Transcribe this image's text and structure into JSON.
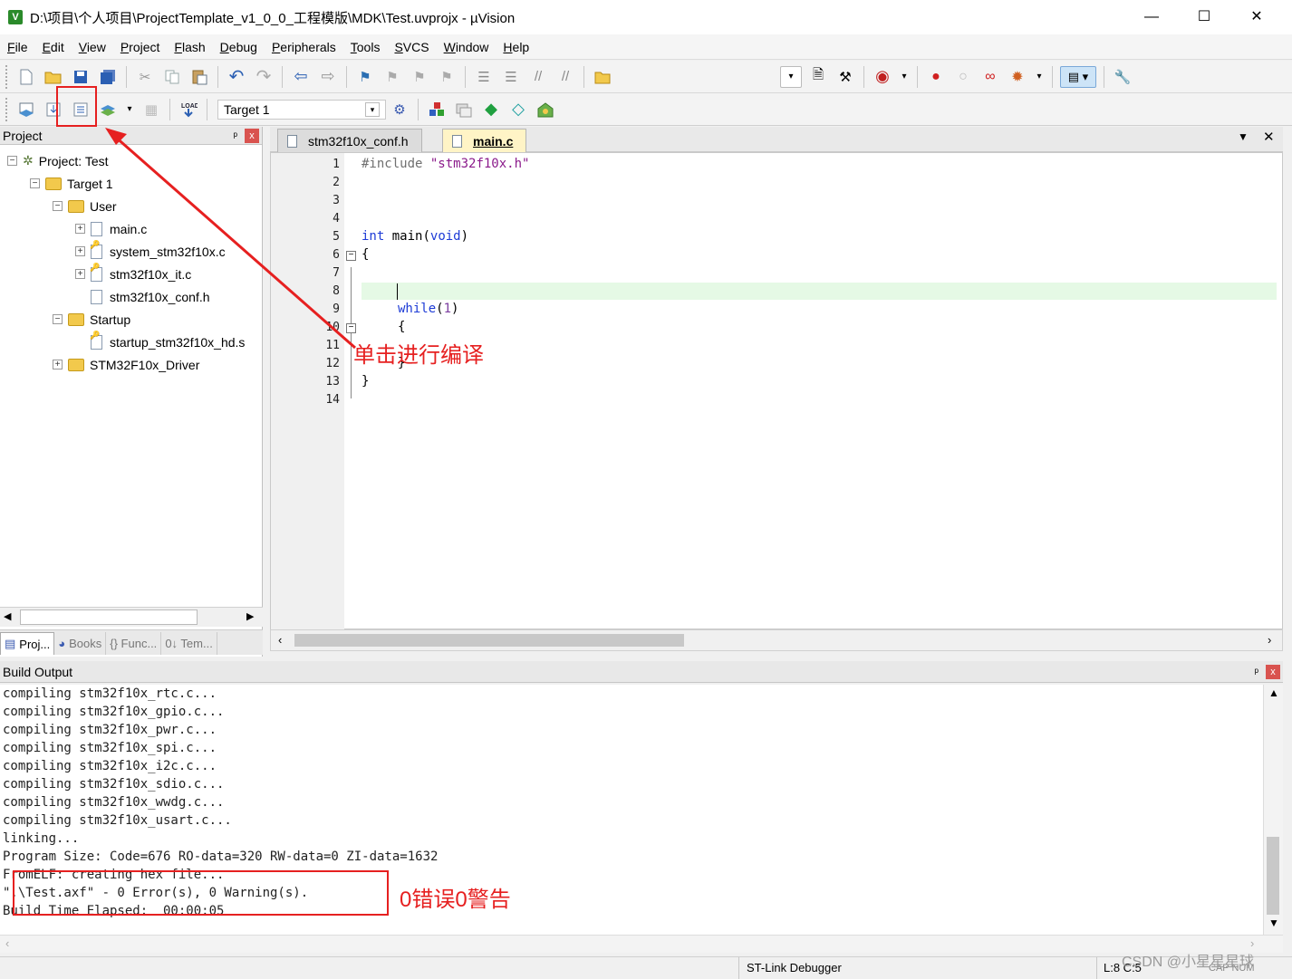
{
  "window": {
    "title": "D:\\项目\\个人项目\\ProjectTemplate_v1_0_0_工程模版\\MDK\\Test.uvprojx - µVision",
    "app_icon": "V",
    "minimize": "—",
    "maximize": "☐",
    "close": "✕"
  },
  "menu": {
    "items": [
      {
        "label": "File",
        "accel": "F",
        "rest": "ile"
      },
      {
        "label": "Edit",
        "accel": "E",
        "rest": "dit"
      },
      {
        "label": "View",
        "accel": "V",
        "rest": "iew"
      },
      {
        "label": "Project",
        "accel": "P",
        "rest": "roject"
      },
      {
        "label": "Flash",
        "accel": "F",
        "rest": "lash"
      },
      {
        "label": "Debug",
        "accel": "D",
        "rest": "ebug"
      },
      {
        "label": "Peripherals",
        "accel": "P",
        "rest": "eripherals"
      },
      {
        "label": "Tools",
        "accel": "T",
        "rest": "ools"
      },
      {
        "label": "SVCS",
        "accel": "S",
        "rest": "VCS"
      },
      {
        "label": "Window",
        "accel": "W",
        "rest": "indow"
      },
      {
        "label": "Help",
        "accel": "H",
        "rest": "elp"
      }
    ]
  },
  "toolbar2": {
    "target": "Target 1"
  },
  "project_panel": {
    "title": "Project",
    "pin": "ᵖ",
    "close": "x",
    "tree": {
      "root": "Project: Test",
      "target": "Target 1",
      "group_user": "User",
      "user_files": [
        "main.c",
        "system_stm32f10x.c",
        "stm32f10x_it.c",
        "stm32f10x_conf.h"
      ],
      "group_startup": "Startup",
      "startup_files": [
        "startup_stm32f10x_hd.s"
      ],
      "group_driver": "STM32F10x_Driver"
    },
    "tabs": [
      "Proj...",
      "Books",
      "{} Func...",
      "0↓ Tem..."
    ]
  },
  "editor": {
    "tabs": [
      "stm32f10x_conf.h",
      "main.c"
    ],
    "active_tab": "main.c",
    "line_numbers": [
      "1",
      "2",
      "3",
      "4",
      "5",
      "6",
      "7",
      "8",
      "9",
      "10",
      "11",
      "12",
      "13",
      "14"
    ],
    "code": {
      "include_kw": "#include",
      "include_file": "\"stm32f10x.h\"",
      "int_kw": "int",
      "main_name": " main",
      "open_paren": "(",
      "void_kw": "void",
      "close_paren": ")",
      "brace_open": "{",
      "while_kw": "while",
      "while_arg_open": "(",
      "while_arg": "1",
      "while_arg_close": ")",
      "inner_open": "{",
      "inner_close": "}",
      "brace_close": "}"
    }
  },
  "build_output": {
    "title": "Build Output",
    "lines": [
      "compiling stm32f10x_rtc.c...",
      "compiling stm32f10x_gpio.c...",
      "compiling stm32f10x_pwr.c...",
      "compiling stm32f10x_spi.c...",
      "compiling stm32f10x_i2c.c...",
      "compiling stm32f10x_sdio.c...",
      "compiling stm32f10x_wwdg.c...",
      "compiling stm32f10x_usart.c...",
      "linking...",
      "Program Size: Code=676 RO-data=320 RW-data=0 ZI-data=1632",
      "FromELF: creating hex file...",
      "\".\\Test.axf\" - 0 Error(s), 0 Warning(s).",
      "Build Time Elapsed:  00:00:05"
    ]
  },
  "status_bar": {
    "debugger": "ST-Link Debugger",
    "position": "L:8 C:5",
    "caps": "CAP NUM"
  },
  "annotations": {
    "compile_hint": "单击进行编译",
    "result_hint": "0错误0警告"
  },
  "watermark": "CSDN @小星星星球",
  "colors": {
    "annotation_red": "#e62020",
    "keyword_blue": "#1d3bd6",
    "active_tab_bg": "#fff4c6",
    "current_line": "#e5f9e5"
  }
}
